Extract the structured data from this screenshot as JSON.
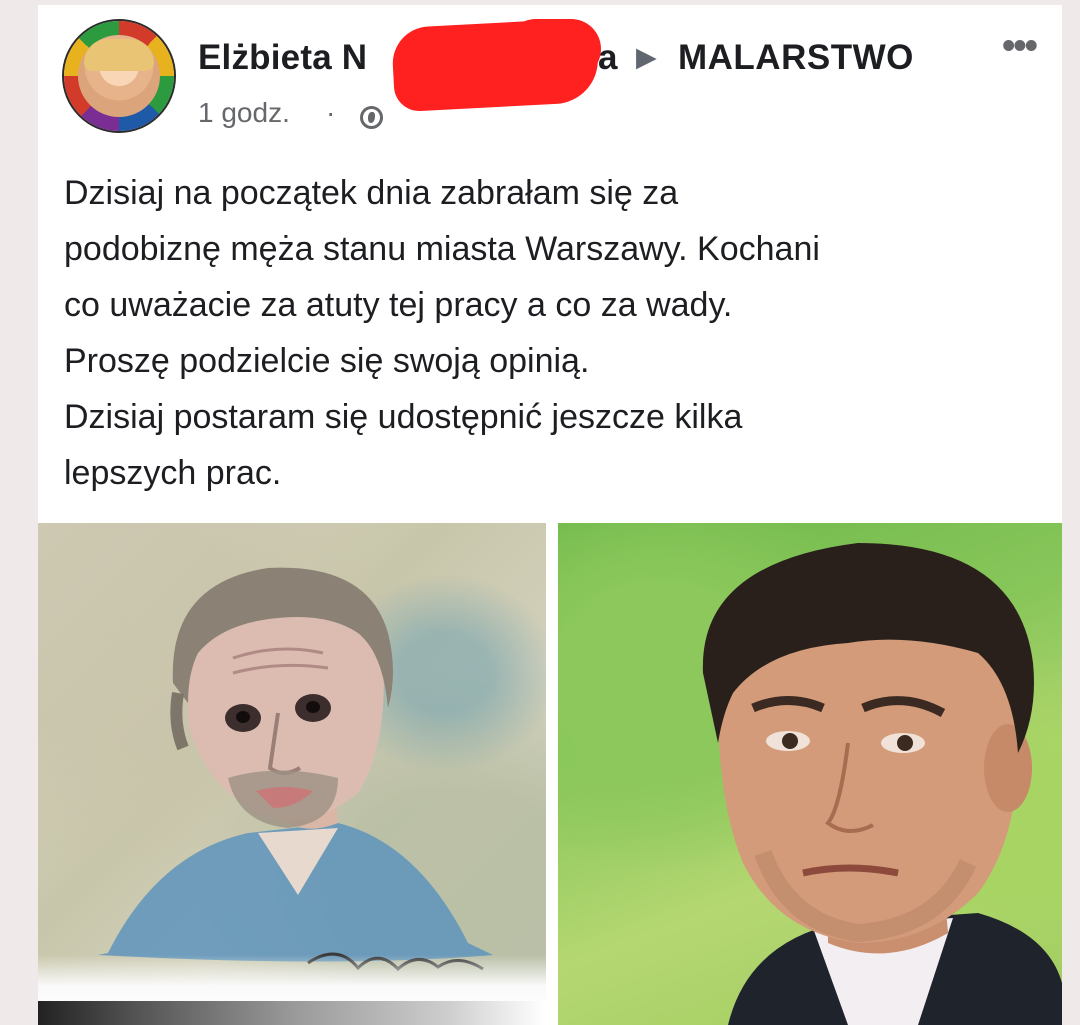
{
  "post": {
    "author_visible_start": "Elżbieta N",
    "author_visible_end": "a",
    "separator_icon": "right-triangle-icon",
    "group_name": "MALARSTWO",
    "more_label": "•••",
    "timestamp": "1 godz.",
    "time_separator": "·",
    "privacy_icon": "globe-icon",
    "paragraphs": [
      "Dzisiaj na początek dnia zabrałam się za",
      "podobiznę męża stanu miasta Warszawy. Kochani",
      "co uważacie za atuty tej pracy a co za wady.",
      "Proszę podzielcie się swoją opinią.",
      "Dzisiaj postaram się udostępnić jeszcze kilka",
      "lepszych prac."
    ]
  },
  "colors": {
    "redaction": "#ff2020",
    "text_primary": "#1c1e21",
    "text_secondary": "#65676b"
  }
}
